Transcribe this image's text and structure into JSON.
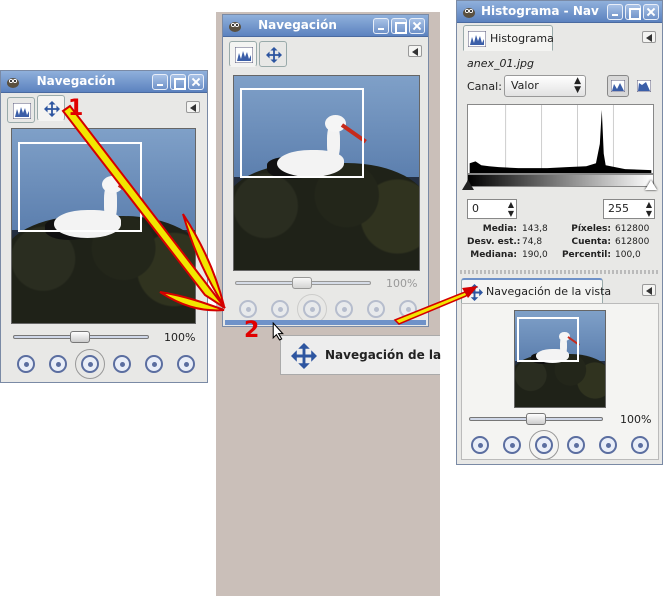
{
  "panel1": {
    "title": "Navegación",
    "zoom": "100%",
    "step_number": "1"
  },
  "panel2": {
    "title": "Navegación",
    "zoom": "100%",
    "step_number": "2",
    "menu_item": "Navegación de la"
  },
  "panel3": {
    "title": "Histograma - Nav",
    "tab_histogram": "Histograma",
    "filename": "anex_01.jpg",
    "channel_label": "Canal:",
    "channel_value": "Valor",
    "range_low": "0",
    "range_high": "255",
    "stats": {
      "media_label": "Media:",
      "media": "143,8",
      "desv_label": "Desv. est.:",
      "desv": "74,8",
      "mediana_label": "Mediana:",
      "mediana": "190,0",
      "pixeles_label": "Píxeles:",
      "pixeles": "612800",
      "cuenta_label": "Cuenta:",
      "cuenta": "612800",
      "percentil_label": "Percentil:",
      "percentil": "100,0"
    },
    "tab_navigation": "Navegación de la vista",
    "zoom": "100%"
  },
  "colors": {
    "titlebar": "#6f92c9",
    "callout": "#e00000",
    "arrow_fill": "#f2e600"
  }
}
